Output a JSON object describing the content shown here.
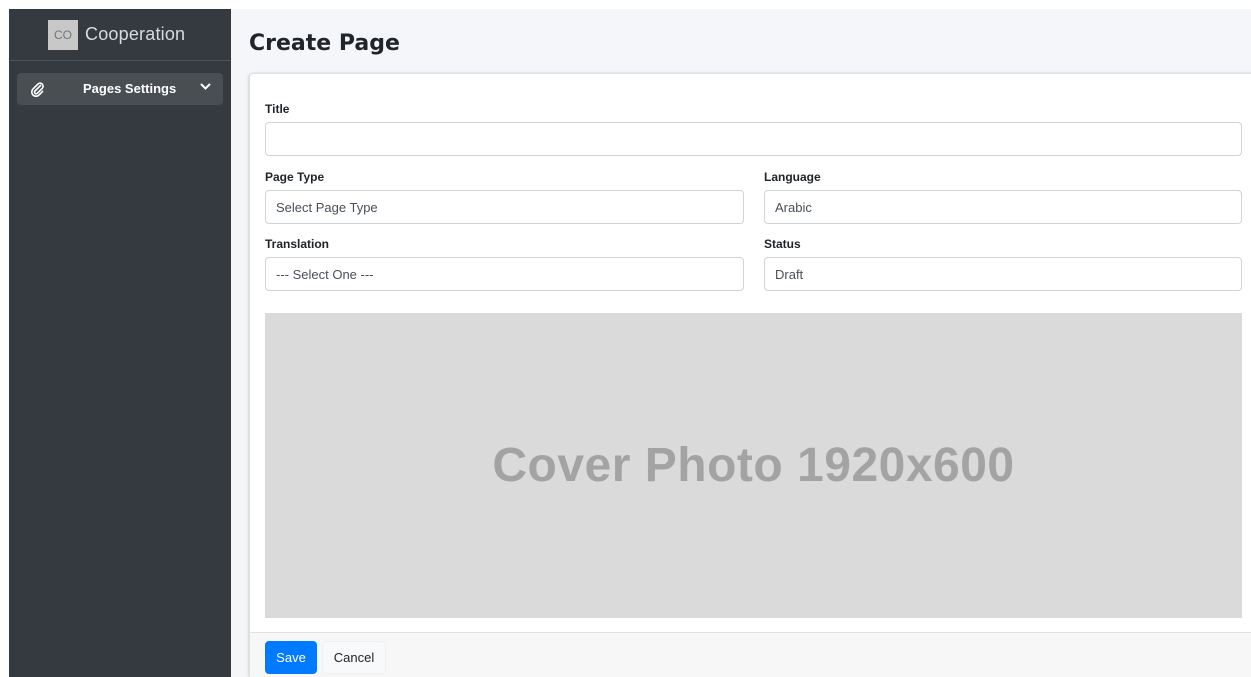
{
  "sidebar": {
    "brand_abbr": "CO",
    "brand_name": "Cooperation",
    "items": [
      {
        "icon": "paperclip-icon",
        "label": "Pages Settings"
      }
    ]
  },
  "page": {
    "title": "Create Page"
  },
  "form": {
    "title_label": "Title",
    "title_value": "",
    "page_type_label": "Page Type",
    "page_type_value": "Select Page Type",
    "language_label": "Language",
    "language_value": "Arabic",
    "translation_label": "Translation",
    "translation_value": "--- Select One ---",
    "status_label": "Status",
    "status_value": "Draft",
    "cover_text": "Cover Photo 1920x600"
  },
  "footer": {
    "save_label": "Save",
    "cancel_label": "Cancel"
  },
  "colors": {
    "sidebar_bg": "#343a40",
    "primary": "#007bff",
    "cover_bg": "#dadada"
  }
}
